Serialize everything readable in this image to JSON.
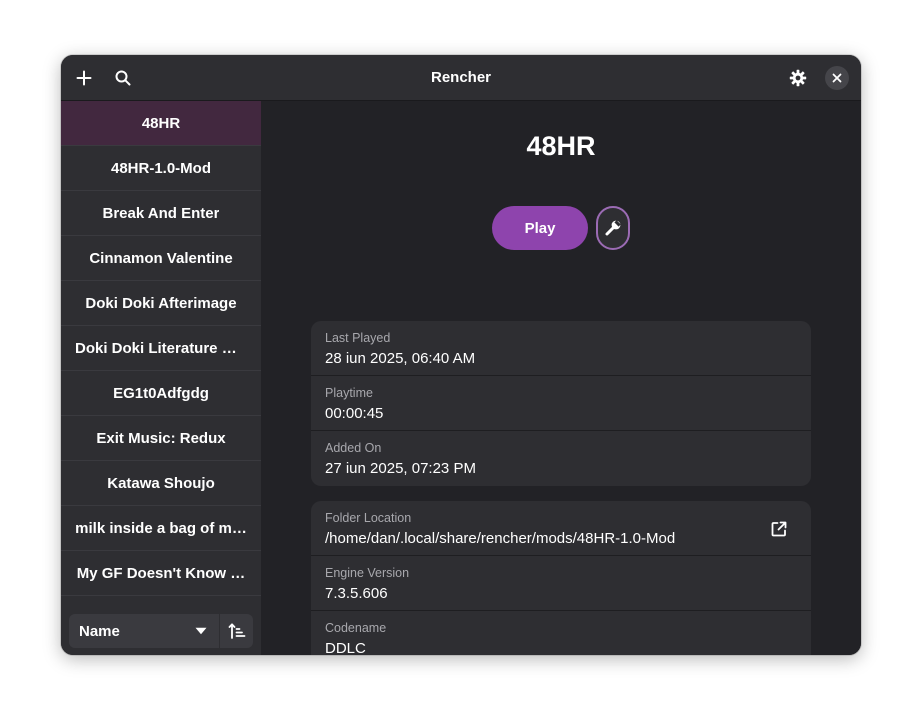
{
  "app": {
    "title": "Rencher"
  },
  "header": {
    "add_icon": "plus-icon",
    "search_icon": "search-icon",
    "settings_icon": "gear-icon",
    "close_icon": "close-icon"
  },
  "sidebar": {
    "items": [
      {
        "label": "48HR",
        "selected": true
      },
      {
        "label": "48HR-1.0-Mod",
        "selected": false
      },
      {
        "label": "Break And Enter",
        "selected": false
      },
      {
        "label": "Cinnamon Valentine",
        "selected": false
      },
      {
        "label": "Doki Doki Afterimage",
        "selected": false
      },
      {
        "label": "Doki Doki Literature C…",
        "selected": false
      },
      {
        "label": "EG1t0Adfgdg",
        "selected": false
      },
      {
        "label": "Exit Music: Redux",
        "selected": false
      },
      {
        "label": "Katawa Shoujo",
        "selected": false
      },
      {
        "label": "milk inside a bag of m…",
        "selected": false
      },
      {
        "label": "My GF Doesn't Know …",
        "selected": false
      }
    ],
    "sort": {
      "selected": "Name",
      "order_icon": "sort-ascending-icon"
    }
  },
  "detail": {
    "title": "48HR",
    "play_label": "Play",
    "tools_icon": "wrench-icon",
    "stats": [
      {
        "label": "Last Played",
        "value": "28 iun 2025, 06:40 AM"
      },
      {
        "label": "Playtime",
        "value": "00:00:45"
      },
      {
        "label": "Added On",
        "value": "27 iun 2025, 07:23 PM"
      }
    ],
    "info": [
      {
        "label": "Folder Location",
        "value": "/home/dan/.local/share/rencher/mods/48HR-1.0-Mod",
        "action_icon": "open-external-icon"
      },
      {
        "label": "Engine Version",
        "value": "7.3.5.606"
      },
      {
        "label": "Codename",
        "value": "DDLC"
      }
    ]
  },
  "colors": {
    "accent": "#8e44ad",
    "selected_row": "#42283f",
    "window_bg": "#222226",
    "card_bg": "#2e2e32"
  }
}
